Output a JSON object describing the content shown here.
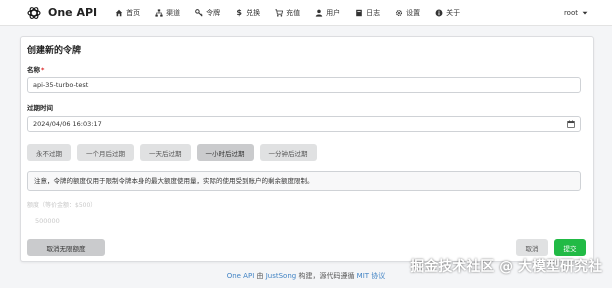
{
  "header": {
    "app_name": "One API",
    "nav": [
      {
        "label": "首页",
        "icon": "home-icon"
      },
      {
        "label": "渠道",
        "icon": "sitemap-icon"
      },
      {
        "label": "令牌",
        "icon": "key-icon"
      },
      {
        "label": "兑换",
        "icon": "dollar-icon"
      },
      {
        "label": "充值",
        "icon": "cart-icon"
      },
      {
        "label": "用户",
        "icon": "user-icon"
      },
      {
        "label": "日志",
        "icon": "book-icon"
      },
      {
        "label": "设置",
        "icon": "gear-icon"
      },
      {
        "label": "关于",
        "icon": "info-icon"
      }
    ],
    "user": "root"
  },
  "form": {
    "title": "创建新的令牌",
    "name_label": "名称",
    "required_mark": "*",
    "name_value": "api-35-turbo-test",
    "expire_label": "过期时间",
    "expire_value": "2024/04/06 16:03:17",
    "expire_buttons": [
      "永不过期",
      "一个月后过期",
      "一天后过期",
      "一小时后过期",
      "一分钟后过期"
    ],
    "active_expire_index": 3,
    "notice": "注意，令牌的额度仅用于限制令牌本身的最大额度使用量，实际的使用受到账户的剩余额度限制。",
    "quota_label": "额度（等价金额：$500）",
    "quota_value": "500000",
    "unlimited_button": "取消无限额度",
    "cancel_button": "取消",
    "submit_button": "提交"
  },
  "footer": {
    "link1": "One API",
    "text1": " 由 ",
    "link2": "JustSong",
    "text2": " 构建，源代码遵循 ",
    "link3": "MIT 协议"
  },
  "watermark": "掘金技术社区 @ 大模型研究社",
  "colors": {
    "submit": "#21ba45",
    "link": "#4183c4",
    "required": "#db2828"
  }
}
